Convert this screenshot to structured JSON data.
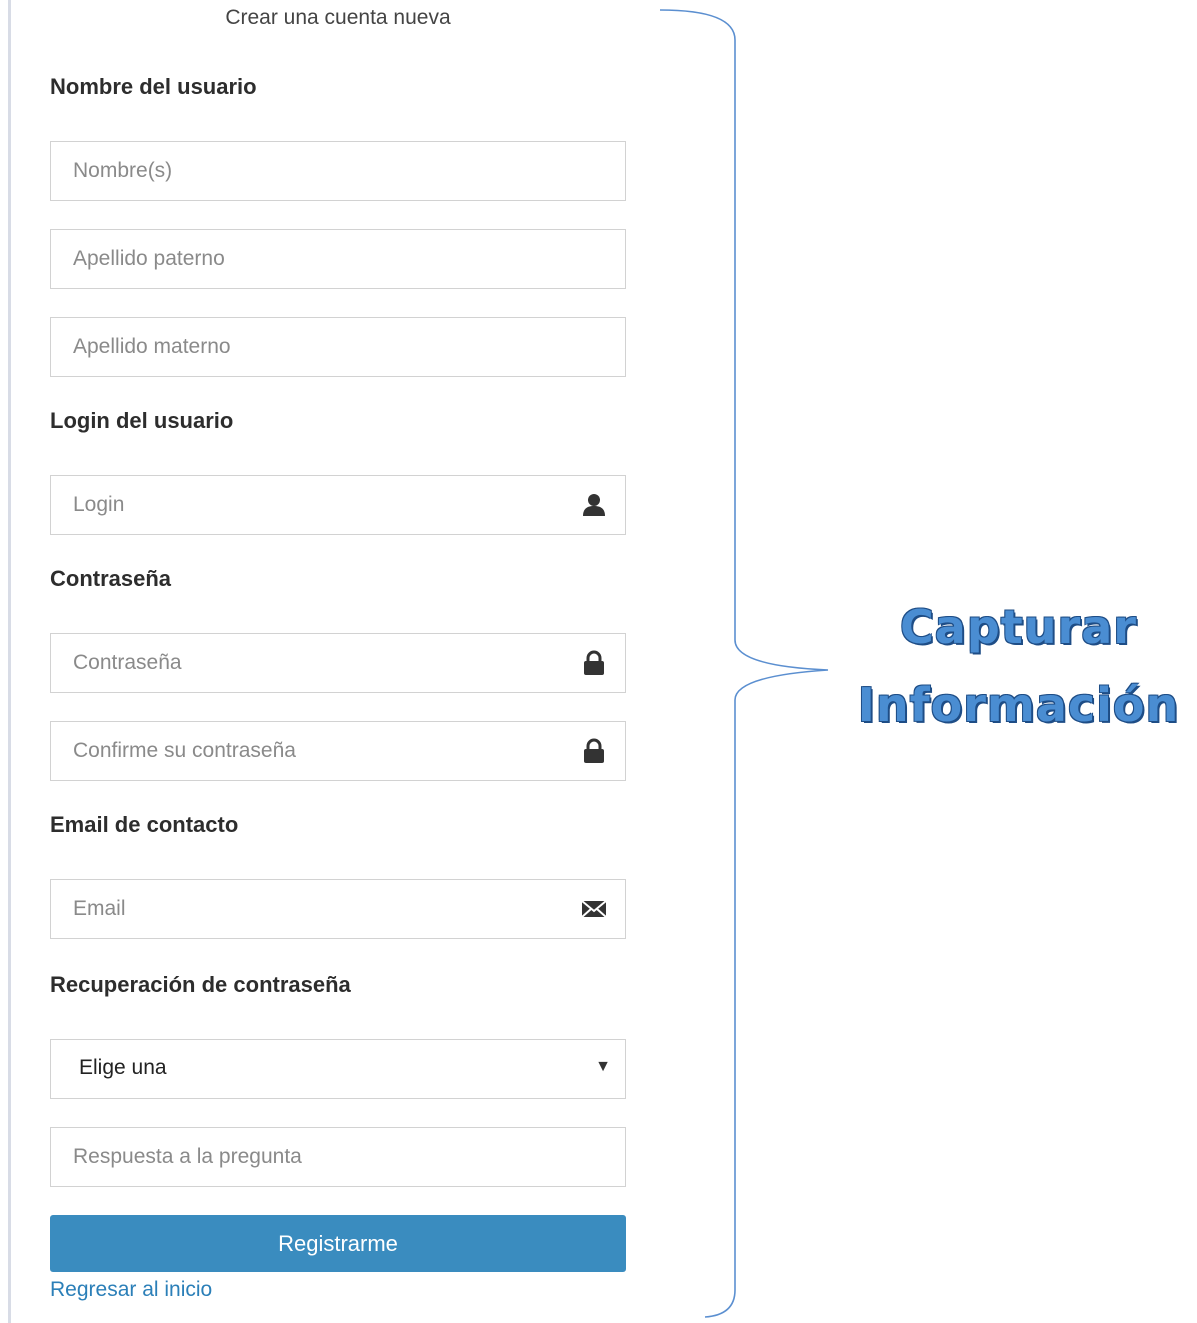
{
  "form": {
    "title": "Crear una cuenta nueva",
    "sections": {
      "name": "Nombre del usuario",
      "login": "Login del usuario",
      "password": "Contraseña",
      "email": "Email de contacto",
      "recovery": "Recuperación de contraseña"
    },
    "fields": {
      "first_name_placeholder": "Nombre(s)",
      "paternal_surname_placeholder": "Apellido paterno",
      "maternal_surname_placeholder": "Apellido materno",
      "login_placeholder": "Login",
      "password_placeholder": "Contraseña",
      "confirm_password_placeholder": "Confirme su contraseña",
      "email_placeholder": "Email",
      "recovery_question_value": "Elige una",
      "recovery_answer_placeholder": "Respuesta a la pregunta"
    },
    "icons": {
      "login": "user-icon",
      "password": "lock-icon",
      "confirm_password": "lock-icon",
      "email": "envelope-icon",
      "select": "caret-down-icon"
    },
    "submit_label": "Registrarme",
    "back_link_label": "Regresar al inicio"
  },
  "annotation": {
    "line1": "Capturar",
    "line2": "Información"
  },
  "colors": {
    "button": "#3a8cbf",
    "link": "#2b7fb8",
    "annotation": "#4a8dd2",
    "brace": "#5b8fd0"
  }
}
